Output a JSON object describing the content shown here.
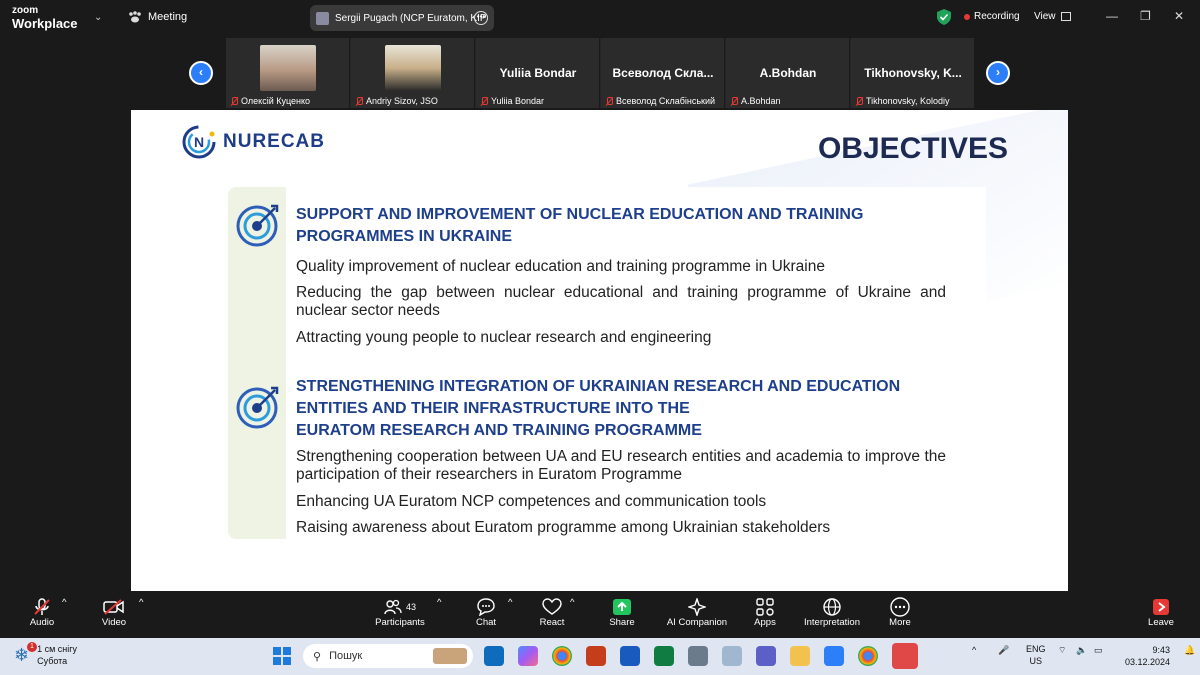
{
  "app": {
    "brand_line1": "zoom",
    "brand_line2": "Workplace",
    "meeting_label": "Meeting",
    "share_title": "Sergii Pugach (NCP Euratom, KIP",
    "recording_label": "Recording",
    "view_label": "View"
  },
  "participants": [
    {
      "label": "Олексій Куценко",
      "display": "",
      "has_video": true,
      "face_color": "#b89a84"
    },
    {
      "label": "Andriy Sizov, JSO",
      "display": "",
      "has_video": true,
      "face_color": "#c8b08a"
    },
    {
      "label": "Yuliia Bondar",
      "display": "Yuliia Bondar",
      "has_video": false
    },
    {
      "label": "Всеволод Склабінський",
      "display": "Всеволод Скла...",
      "has_video": false
    },
    {
      "label": "A.Bohdan",
      "display": "A.Bohdan",
      "has_video": false
    },
    {
      "label": "Tikhonovsky, Kolodiy",
      "display": "Tikhonovsky, K...",
      "has_video": false
    }
  ],
  "slide": {
    "logo_text": "NURECAB",
    "title": "OBJECTIVES",
    "section1": {
      "heading_line1": "SUPPORT AND IMPROVEMENT OF NUCLEAR EDUCATION AND TRAINING",
      "heading_line2": "PROGRAMMES IN UKRAINE",
      "items": [
        "Quality improvement of nuclear education and training programme in Ukraine",
        "Reducing the gap between nuclear educational and training programme of Ukraine and nuclear sector needs",
        "Attracting young people to nuclear research and engineering"
      ]
    },
    "section2": {
      "heading_line1": "STRENGTHENING INTEGRATION OF UKRAINIAN RESEARCH AND EDUCATION",
      "heading_line2": "ENTITIES AND THEIR INFRASTRUCTURE INTO THE",
      "heading_line3": "EURATOM RESEARCH AND TRAINING PROGRAMME",
      "items": [
        "Strengthening cooperation between UA and EU research entities and academia to improve the participation of their researchers in Euratom Programme",
        "Enhancing UA Euratom NCP competences and communication tools",
        "Raising awareness about Euratom programme among Ukrainian stakeholders"
      ]
    }
  },
  "toolbar": {
    "audio": "Audio",
    "video": "Video",
    "participants": "Participants",
    "participants_count": "43",
    "chat": "Chat",
    "react": "React",
    "share": "Share",
    "ai_companion": "AI Companion",
    "apps": "Apps",
    "interpretation": "Interpretation",
    "more": "More",
    "leave": "Leave"
  },
  "taskbar": {
    "weather_line1": "1 см снігу",
    "weather_line2": "Субота",
    "notification_count": "1",
    "search_placeholder": "Пошук",
    "lang_line1": "ENG",
    "lang_line2": "US",
    "time": "9:43",
    "date": "03.12.2024"
  },
  "colors": {
    "accent": "#2d7ff9",
    "heading": "#1e3f8c",
    "title": "#1d2a52",
    "recording": "#e53935",
    "share_green": "#22c55e"
  }
}
